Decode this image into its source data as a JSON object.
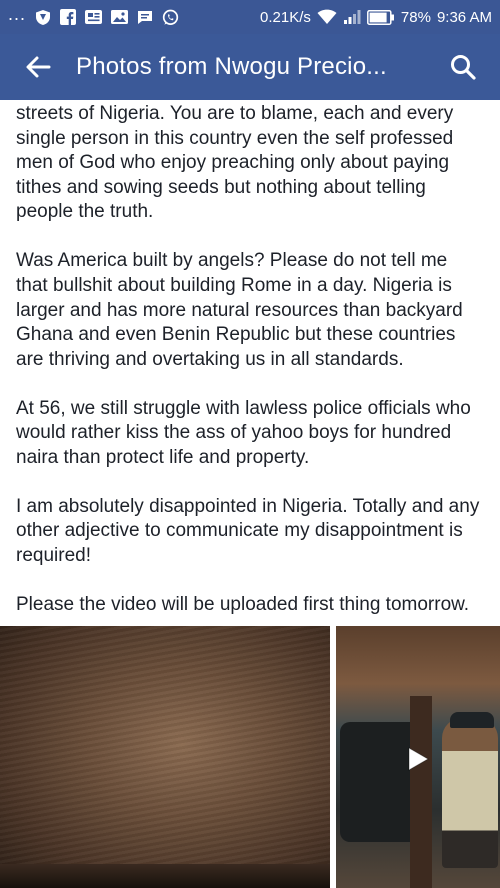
{
  "status_bar": {
    "more": "...",
    "network_speed": "0.21K/s",
    "battery": "78%",
    "time": "9:36 AM"
  },
  "app_bar": {
    "title": "Photos from Nwogu Precio..."
  },
  "post": {
    "paragraphs": [
      "streets of Nigeria. You are to blame, each and every single person in this country even the self professed men of God who enjoy preaching only about paying tithes and sowing seeds but nothing about telling people the truth.",
      "Was America built by angels? Please do not tell me that bullshit about building Rome in a day. Nigeria is larger and has more natural resources than backyard Ghana and even Benin Republic but these countries are thriving and overtaking us in all standards.",
      "At 56, we still struggle with lawless police officials who would rather kiss the ass of yahoo boys for hundred naira than protect life and property.",
      "I am absolutely disappointed in Nigeria. Totally and any other adjective to communicate my disappointment is required!",
      "Please the video will be uploaded first thing tomorrow."
    ]
  },
  "colors": {
    "brand": "#3b5998",
    "text": "#1d2129"
  },
  "icons": {
    "back": "arrow-back-icon",
    "search": "search-icon",
    "play": "play-icon"
  }
}
